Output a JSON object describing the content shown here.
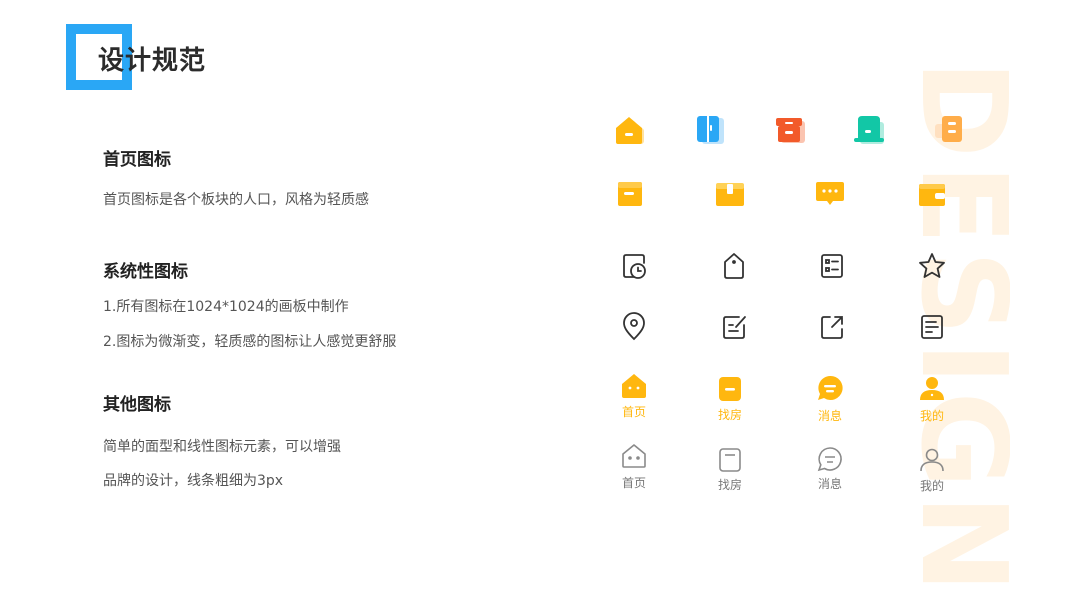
{
  "page": {
    "title": "设计规范",
    "background_word": "DESIGN"
  },
  "sections": [
    {
      "title": "首页图标",
      "lines": [
        "首页图标是各个板块的人口，风格为轻质感"
      ]
    },
    {
      "title": "系统性图标",
      "lines": [
        "1.所有图标在1024*1024的画板中制作",
        "2.图标为微渐变，轻质感的图标让人感觉更舒服"
      ]
    },
    {
      "title": "其他图标",
      "lines": [
        "简单的面型和线性图标元素，可以增强",
        "品牌的设计，线条粗细为3px"
      ]
    }
  ],
  "colors": {
    "accent_blue": "#2aa7f5",
    "orange": "#f25a2a",
    "teal": "#12c7a6",
    "yellow": "#ffb70f",
    "light_orange": "#ffad4a",
    "line_dark": "#333333",
    "line_gray": "#8a8a8a"
  },
  "icons": {
    "home_row1": [
      "house-icon",
      "wardrobe-icon",
      "storage-box-icon",
      "bed-icon",
      "sofa-icon"
    ],
    "home_row2": [
      "drawer-icon",
      "toolbox-icon",
      "chat-bubble-icon",
      "wallet-icon"
    ],
    "system_row1": [
      "clock-document-icon",
      "tag-icon",
      "checklist-icon",
      "star-icon"
    ],
    "system_row2": [
      "location-pin-icon",
      "edit-icon",
      "share-icon",
      "notes-icon"
    ]
  },
  "nav_active": [
    {
      "label": "首页",
      "icon": "home-filled-icon"
    },
    {
      "label": "找房",
      "icon": "find-house-filled-icon"
    },
    {
      "label": "消息",
      "icon": "message-filled-icon"
    },
    {
      "label": "我的",
      "icon": "profile-filled-icon"
    }
  ],
  "nav_inactive": [
    {
      "label": "首页",
      "icon": "home-outline-icon"
    },
    {
      "label": "找房",
      "icon": "find-house-outline-icon"
    },
    {
      "label": "消息",
      "icon": "message-outline-icon"
    },
    {
      "label": "我的",
      "icon": "profile-outline-icon"
    }
  ]
}
